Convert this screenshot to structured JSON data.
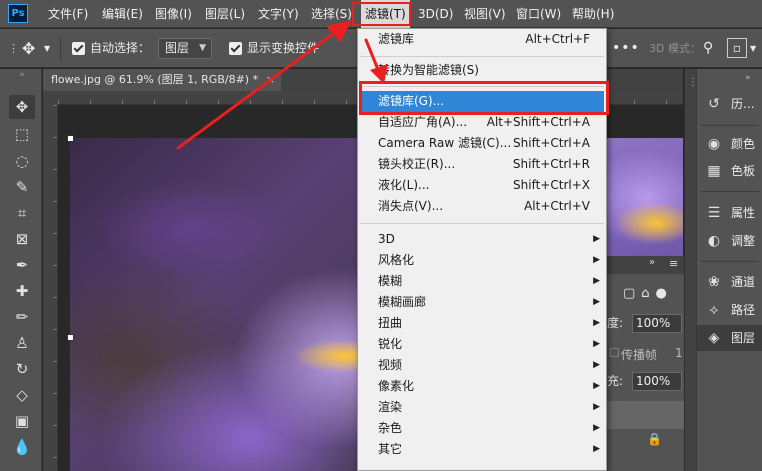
{
  "app": {
    "logo": "Ps"
  },
  "menubar": [
    {
      "label": "文件(F)"
    },
    {
      "label": "编辑(E)"
    },
    {
      "label": "图像(I)"
    },
    {
      "label": "图层(L)"
    },
    {
      "label": "文字(Y)"
    },
    {
      "label": "选择(S)"
    },
    {
      "label": "滤镜(T)"
    },
    {
      "label": "3D(D)"
    },
    {
      "label": "视图(V)"
    },
    {
      "label": "窗口(W)"
    },
    {
      "label": "帮助(H)"
    }
  ],
  "options": {
    "auto_select_label": "自动选择：",
    "layer_select_value": "图层",
    "show_transform_label": "显示变换控件",
    "mode_label": "3D 模式："
  },
  "document": {
    "tab_title": "flowe.jpg @ 61.9% (图层 1, RGB/8#) *",
    "close_glyph": "×"
  },
  "filter_menu": {
    "items": [
      {
        "label": "滤镜库",
        "shortcut": "Alt+Ctrl+F"
      },
      {
        "label": "转换为智能滤镜(S)",
        "shortcut": ""
      },
      {
        "label": "滤镜库(G)...",
        "shortcut": "",
        "highlighted": true
      },
      {
        "label": "自适应广角(A)...",
        "shortcut": "Alt+Shift+Ctrl+A"
      },
      {
        "label": "Camera Raw 滤镜(C)...",
        "shortcut": "Shift+Ctrl+A"
      },
      {
        "label": "镜头校正(R)...",
        "shortcut": "Shift+Ctrl+R"
      },
      {
        "label": "液化(L)...",
        "shortcut": "Shift+Ctrl+X"
      },
      {
        "label": "消失点(V)...",
        "shortcut": "Alt+Ctrl+V"
      },
      {
        "label": "3D",
        "submenu": true
      },
      {
        "label": "风格化",
        "submenu": true
      },
      {
        "label": "模糊",
        "submenu": true
      },
      {
        "label": "模糊画廊",
        "submenu": true
      },
      {
        "label": "扭曲",
        "submenu": true
      },
      {
        "label": "锐化",
        "submenu": true
      },
      {
        "label": "视频",
        "submenu": true
      },
      {
        "label": "像素化",
        "submenu": true
      },
      {
        "label": "渲染",
        "submenu": true
      },
      {
        "label": "杂色",
        "submenu": true
      },
      {
        "label": "其它",
        "submenu": true
      }
    ]
  },
  "layers_partial": {
    "opacity_label": "度:",
    "opacity_value": "100%",
    "propagate_label": "传播帧",
    "propagate_value": "1",
    "fill_label": "充:",
    "fill_value": "100%"
  },
  "side_panel": [
    {
      "icon": "history-icon",
      "label": "历..."
    },
    {
      "icon": "color-icon",
      "label": "颜色"
    },
    {
      "icon": "swatches-icon",
      "label": "色板"
    },
    {
      "icon": "properties-icon",
      "label": "属性"
    },
    {
      "icon": "adjustments-icon",
      "label": "调整"
    },
    {
      "icon": "channels-icon",
      "label": "通道"
    },
    {
      "icon": "paths-icon",
      "label": "路径"
    },
    {
      "icon": "layers-icon",
      "label": "图层"
    }
  ],
  "colors": {
    "annotation_red": "#e82020",
    "menu_highlight": "#2f86d6"
  }
}
